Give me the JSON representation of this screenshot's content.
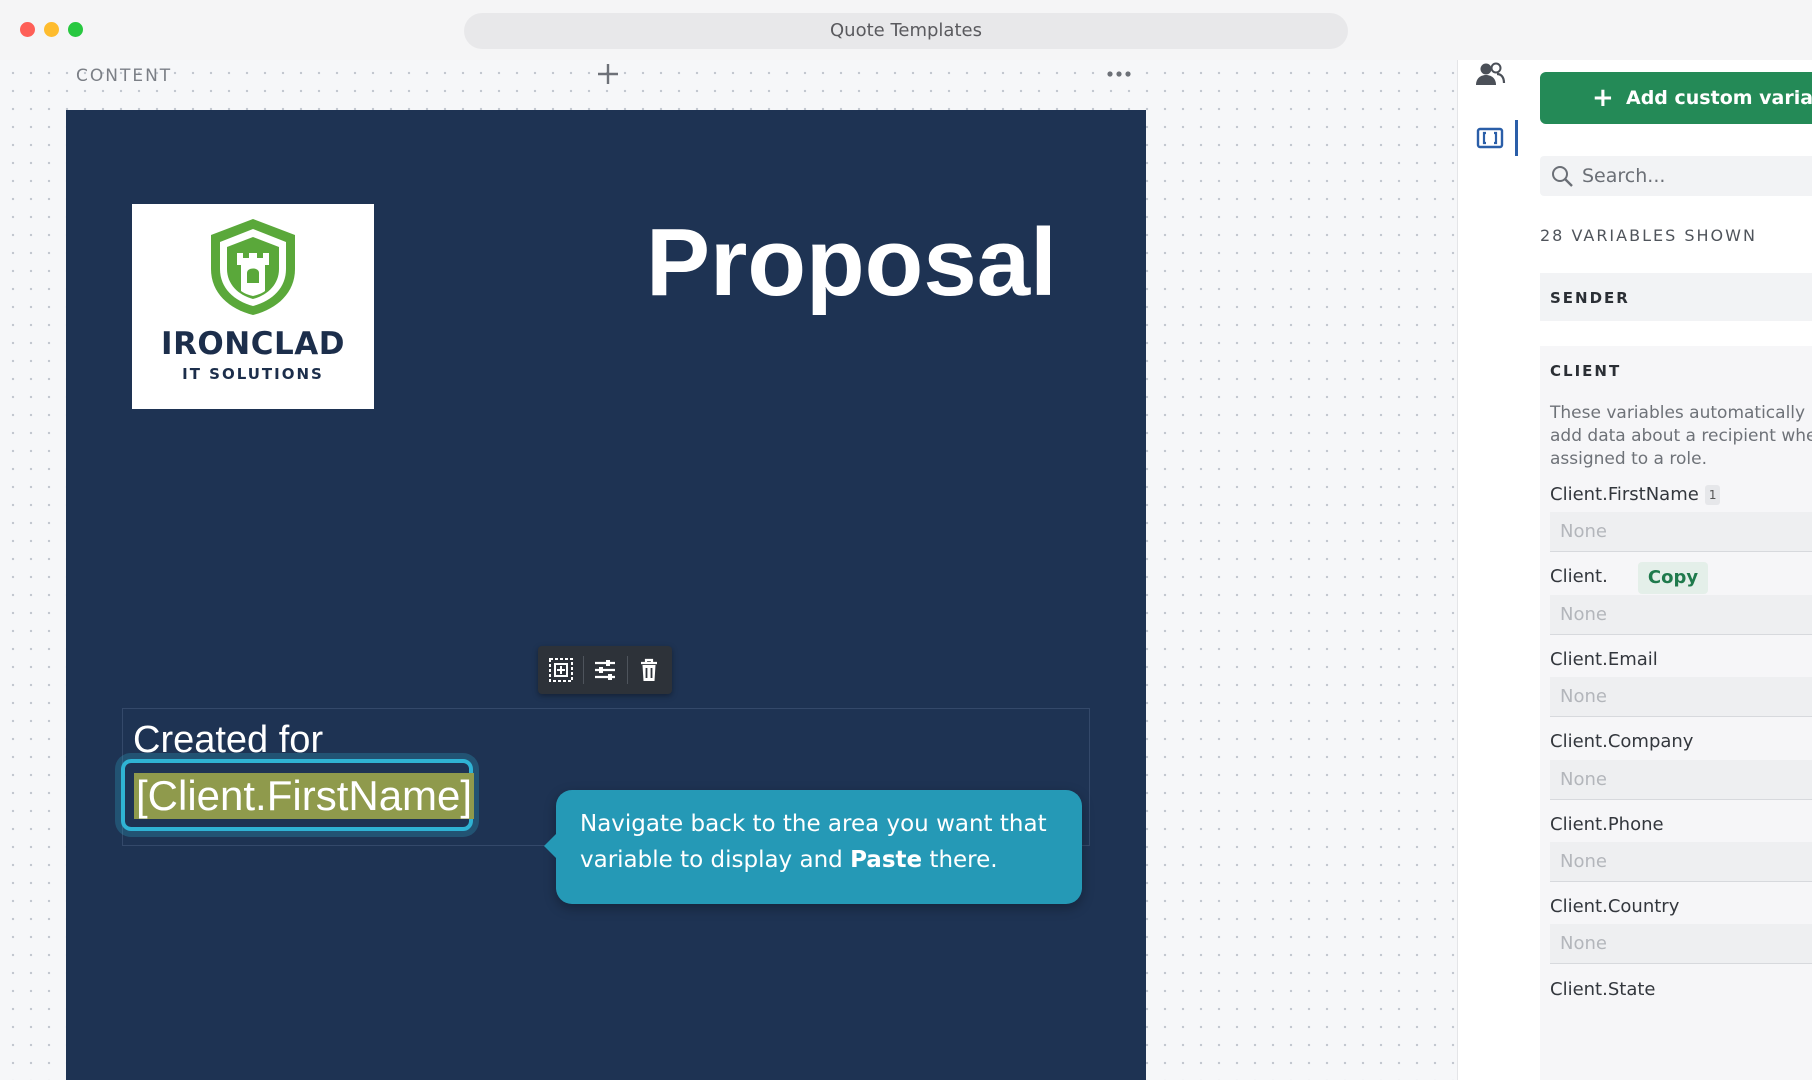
{
  "window": {
    "title": "Quote Templates"
  },
  "canvas": {
    "content_label": "CONTENT",
    "logo": {
      "title": "IRONCLAD",
      "subtitle": "IT SOLUTIONS"
    },
    "doc_title": "Proposal",
    "created_for": "Created for",
    "variable_token": "[Client.FirstName]",
    "tooltip": {
      "before": "Navigate back to the area you want that variable to display and ",
      "bold": "Paste",
      "after": " there."
    }
  },
  "panel": {
    "add_button": "Add custom variable",
    "search_placeholder": "Search...",
    "shown_count": "28 VARIABLES SHOWN",
    "sender_title": "SENDER",
    "client_title": "CLIENT",
    "client_description": "These variables automatically add data about a recipient when assigned to a role.",
    "copy_label": "Copy",
    "vars": [
      {
        "label": "Client.FirstName",
        "badge": "1",
        "value": "None"
      },
      {
        "label": "Client.",
        "value": "None"
      },
      {
        "label": "Client.Email",
        "value": "None"
      },
      {
        "label": "Client.Company",
        "value": "None"
      },
      {
        "label": "Client.Phone",
        "value": "None"
      },
      {
        "label": "Client.Country",
        "value": "None"
      },
      {
        "label": "Client.State"
      }
    ]
  },
  "colors": {
    "doc_bg": "#1e3353",
    "accent_green": "#248a57",
    "tooltip_bg": "#2599b6",
    "highlight": "#2fb3d4"
  }
}
